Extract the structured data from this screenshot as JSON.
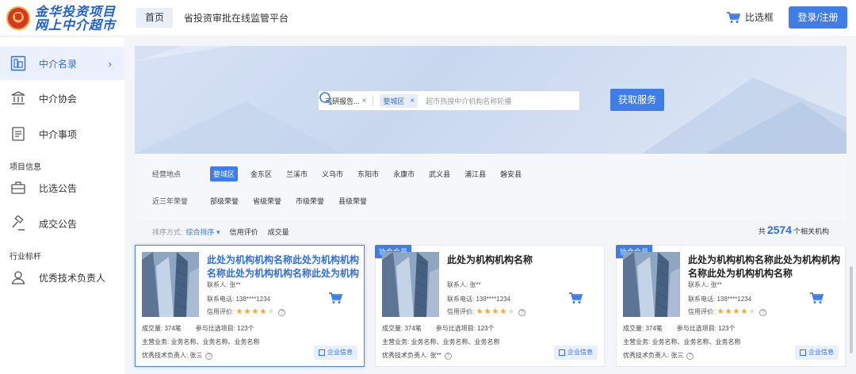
{
  "header": {
    "logo_line1": "金华投资项目",
    "logo_line2": "网上中介超市",
    "nav_home": "首页",
    "nav_platform": "省投资审批在线监管平台",
    "compare_label": "比选框",
    "login_label": "登录/注册"
  },
  "sidebar": {
    "items": [
      {
        "label": "中介名录",
        "icon": "building-icon"
      },
      {
        "label": "中介协会",
        "icon": "institution-icon"
      },
      {
        "label": "中介事项",
        "icon": "document-icon"
      },
      {
        "label": "比选公告",
        "icon": "briefcase-icon"
      },
      {
        "label": "成交公告",
        "icon": "gavel-icon"
      },
      {
        "label": "优秀技术负责人",
        "icon": "person-icon"
      }
    ],
    "group_project": "项目信息",
    "group_industry": "行业标杆"
  },
  "search": {
    "tag1": "可研报告...",
    "tag2": "婺城区",
    "placeholder": "超市热搜中介机构名称轮播",
    "button": "获取服务"
  },
  "filters": {
    "location_label": "经营地点",
    "locations": [
      "婺城区",
      "金东区",
      "兰溪市",
      "义乌市",
      "东阳市",
      "永康市",
      "武义县",
      "浦江县",
      "磐安县"
    ],
    "honor_label": "近三年荣誉",
    "honors": [
      "部级荣誉",
      "省级荣誉",
      "市级荣誉",
      "县级荣誉"
    ]
  },
  "sort": {
    "label": "排序方式:",
    "selected": "综合排序",
    "options": [
      "信用评价",
      "成交量"
    ],
    "count_prefix": "共",
    "count": "2574",
    "count_suffix": "个相关机构"
  },
  "cards": [
    {
      "badge": "",
      "name": "此处为机构机构名称此处为机构机构名称此处为机构机构名称此处为机构机...",
      "contact": "联系人: 张**",
      "phone": "联系电话: 138****1234",
      "rating_label": "信用评价:",
      "rating": 4,
      "deals": "成交量: 374笔",
      "projects": "参与比选项目: 123个",
      "business": "主营业务: 业务名称、业务名称、业务名称",
      "tech_lead": "优秀技术负责人: 张三",
      "info_btn": "企业信息"
    },
    {
      "badge": "协会会员",
      "name": "此处为机构机构名称",
      "contact": "联系人: 张**",
      "phone": "联系电话: 138****1234",
      "rating_label": "信用评价:",
      "rating": 4,
      "deals": "成交量: 374笔",
      "projects": "参与比选项目: 123个",
      "business": "主营业务: 业务名称、业务名称、业务名称",
      "tech_lead": "优秀技术负责人: 张**",
      "info_btn": "企业信息"
    },
    {
      "badge": "协会会员",
      "name": "此处为机构机构名称此处为机构机构名称此处为机构机构名称",
      "contact": "联系人: 张**",
      "phone": "联系电话: 138****1234",
      "rating_label": "信用评价:",
      "rating": 4,
      "deals": "成交量: 374笔",
      "projects": "参与比选项目: 123个",
      "business": "主营业务: 业务名称、业务名称、业务名称",
      "tech_lead": "优秀技术负责人: 张三",
      "info_btn": "企业信息"
    }
  ],
  "colors": {
    "accent": "#3f7ee8",
    "star": "#f5a623"
  }
}
